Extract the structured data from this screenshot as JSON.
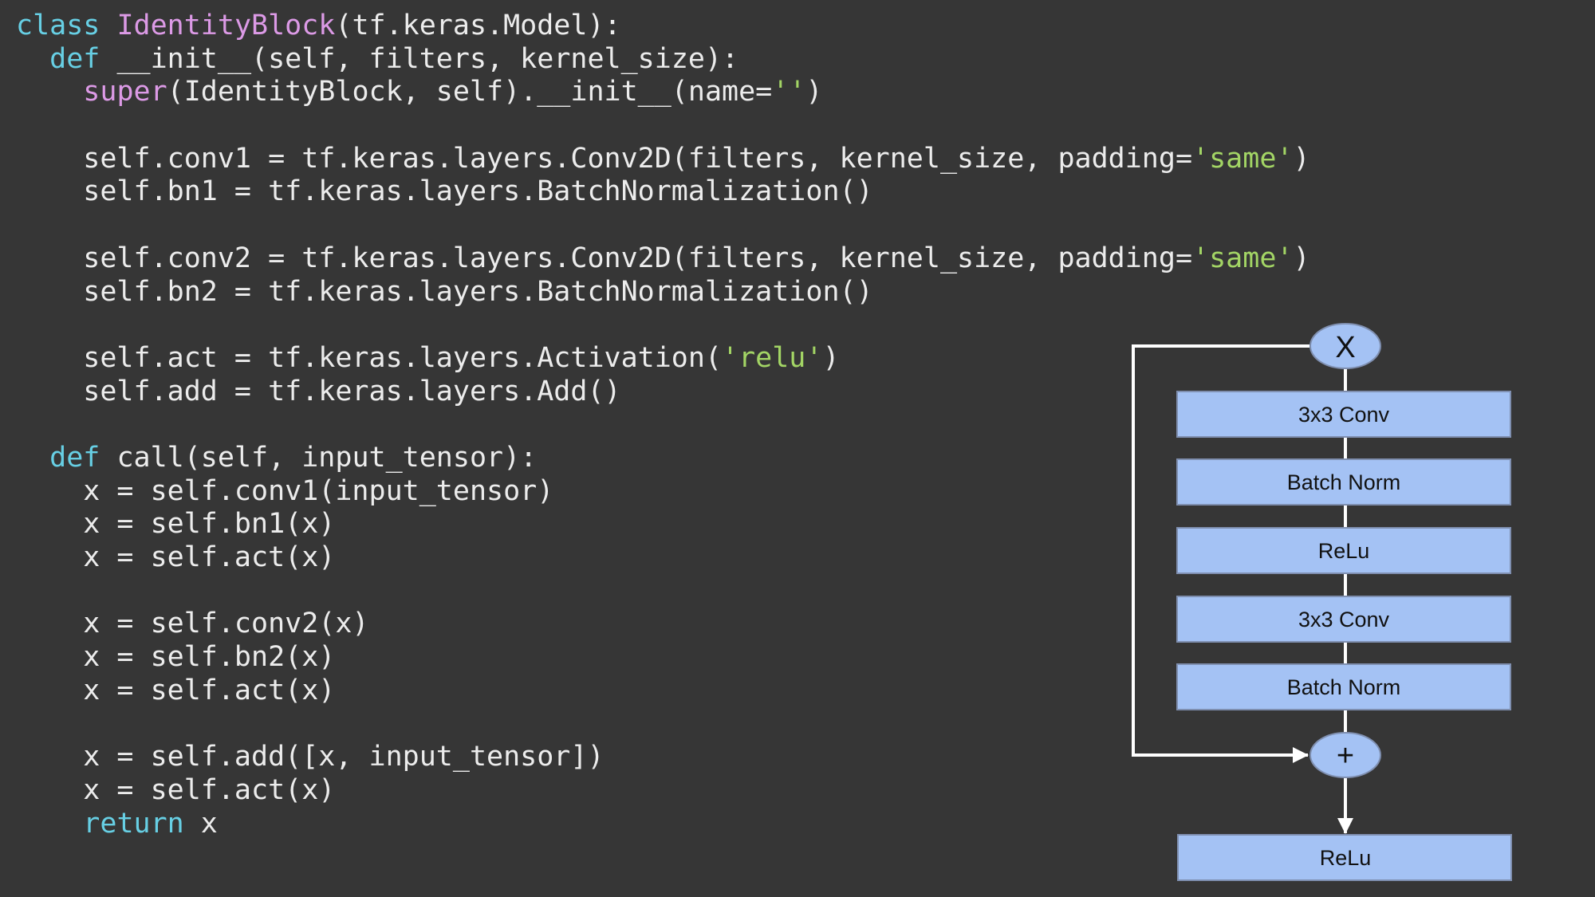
{
  "code_lines": [
    [
      {
        "t": "class ",
        "c": "kw"
      },
      {
        "t": "IdentityBlock",
        "c": "cls"
      },
      {
        "t": "(tf.keras.Model):",
        "c": "plain"
      }
    ],
    [
      {
        "t": "  ",
        "c": "plain"
      },
      {
        "t": "def",
        "c": "kw"
      },
      {
        "t": " __init__(self, filters, kernel_size):",
        "c": "plain"
      }
    ],
    [
      {
        "t": "    ",
        "c": "plain"
      },
      {
        "t": "super",
        "c": "fn"
      },
      {
        "t": "(IdentityBlock, self).__init__(name=",
        "c": "plain"
      },
      {
        "t": "''",
        "c": "str"
      },
      {
        "t": ")",
        "c": "plain"
      }
    ],
    [],
    [
      {
        "t": "    self.conv1 = tf.keras.layers.Conv2D(filters, kernel_size, padding=",
        "c": "plain"
      },
      {
        "t": "'same'",
        "c": "str"
      },
      {
        "t": ")",
        "c": "plain"
      }
    ],
    [
      {
        "t": "    self.bn1 = tf.keras.layers.BatchNormalization()",
        "c": "plain"
      }
    ],
    [],
    [
      {
        "t": "    self.conv2 = tf.keras.layers.Conv2D(filters, kernel_size, padding=",
        "c": "plain"
      },
      {
        "t": "'same'",
        "c": "str"
      },
      {
        "t": ")",
        "c": "plain"
      }
    ],
    [
      {
        "t": "    self.bn2 = tf.keras.layers.BatchNormalization()",
        "c": "plain"
      }
    ],
    [],
    [
      {
        "t": "    self.act = tf.keras.layers.Activation(",
        "c": "plain"
      },
      {
        "t": "'relu'",
        "c": "str"
      },
      {
        "t": ")",
        "c": "plain"
      }
    ],
    [
      {
        "t": "    self.add = tf.keras.layers.Add()",
        "c": "plain"
      }
    ],
    [],
    [
      {
        "t": "  ",
        "c": "plain"
      },
      {
        "t": "def",
        "c": "kw"
      },
      {
        "t": " call(self, input_tensor):",
        "c": "plain"
      }
    ],
    [
      {
        "t": "    x = self.conv1(input_tensor)",
        "c": "plain"
      }
    ],
    [
      {
        "t": "    x = self.bn1(x)",
        "c": "plain"
      }
    ],
    [
      {
        "t": "    x = self.act(x)",
        "c": "plain"
      }
    ],
    [],
    [
      {
        "t": "    x = self.conv2(x)",
        "c": "plain"
      }
    ],
    [
      {
        "t": "    x = self.bn2(x)",
        "c": "plain"
      }
    ],
    [
      {
        "t": "    x = self.act(x)",
        "c": "plain"
      }
    ],
    [],
    [
      {
        "t": "    x = self.add([x, input_tensor])",
        "c": "plain"
      }
    ],
    [
      {
        "t": "    x = self.act(x)",
        "c": "plain"
      }
    ],
    [
      {
        "t": "    ",
        "c": "plain"
      },
      {
        "t": "return",
        "c": "kw"
      },
      {
        "t": " x",
        "c": "plain"
      }
    ]
  ],
  "diagram": {
    "input_node": "X",
    "layers": [
      "3x3 Conv",
      "Batch Norm",
      "ReLu",
      "3x3 Conv",
      "Batch Norm"
    ],
    "add_node": "+",
    "output_layer": "ReLu"
  },
  "colors": {
    "background": "#363636",
    "code_text": "#ececec",
    "keyword": "#67cfe4",
    "class_name": "#dc9ae6",
    "string": "#a3d565",
    "box_fill": "#a4c2f4",
    "box_stroke": "#7f8fb0",
    "connector": "#ffffff"
  }
}
